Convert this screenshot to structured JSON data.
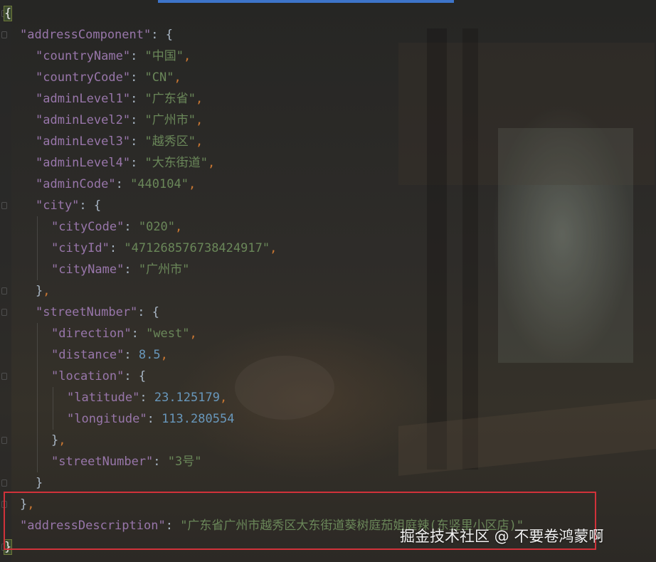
{
  "watermark": "掘金技术社区 @ 不要卷鸿蒙啊",
  "lines": [
    {
      "indent": 0,
      "tokens": [
        {
          "t": "{",
          "c": "brace-hl"
        }
      ]
    },
    {
      "indent": 1,
      "tokens": [
        {
          "t": "\"addressComponent\"",
          "c": "key"
        },
        {
          "t": ": ",
          "c": "brace"
        },
        {
          "t": "{",
          "c": "brace"
        }
      ]
    },
    {
      "indent": 2,
      "tokens": [
        {
          "t": "\"countryName\"",
          "c": "key"
        },
        {
          "t": ": ",
          "c": "brace"
        },
        {
          "t": "\"中国\"",
          "c": "str"
        },
        {
          "t": ",",
          "c": "punct"
        }
      ]
    },
    {
      "indent": 2,
      "tokens": [
        {
          "t": "\"countryCode\"",
          "c": "key"
        },
        {
          "t": ": ",
          "c": "brace"
        },
        {
          "t": "\"CN\"",
          "c": "str"
        },
        {
          "t": ",",
          "c": "punct"
        }
      ]
    },
    {
      "indent": 2,
      "tokens": [
        {
          "t": "\"adminLevel1\"",
          "c": "key"
        },
        {
          "t": ": ",
          "c": "brace"
        },
        {
          "t": "\"广东省\"",
          "c": "str"
        },
        {
          "t": ",",
          "c": "punct"
        }
      ]
    },
    {
      "indent": 2,
      "tokens": [
        {
          "t": "\"adminLevel2\"",
          "c": "key"
        },
        {
          "t": ": ",
          "c": "brace"
        },
        {
          "t": "\"广州市\"",
          "c": "str"
        },
        {
          "t": ",",
          "c": "punct"
        }
      ]
    },
    {
      "indent": 2,
      "tokens": [
        {
          "t": "\"adminLevel3\"",
          "c": "key"
        },
        {
          "t": ": ",
          "c": "brace"
        },
        {
          "t": "\"越秀区\"",
          "c": "str"
        },
        {
          "t": ",",
          "c": "punct"
        }
      ]
    },
    {
      "indent": 2,
      "tokens": [
        {
          "t": "\"adminLevel4\"",
          "c": "key"
        },
        {
          "t": ": ",
          "c": "brace"
        },
        {
          "t": "\"大东街道\"",
          "c": "str"
        },
        {
          "t": ",",
          "c": "punct"
        }
      ]
    },
    {
      "indent": 2,
      "tokens": [
        {
          "t": "\"adminCode\"",
          "c": "key"
        },
        {
          "t": ": ",
          "c": "brace"
        },
        {
          "t": "\"440104\"",
          "c": "str"
        },
        {
          "t": ",",
          "c": "punct"
        }
      ]
    },
    {
      "indent": 2,
      "tokens": [
        {
          "t": "\"city\"",
          "c": "key"
        },
        {
          "t": ": ",
          "c": "brace"
        },
        {
          "t": "{",
          "c": "brace"
        }
      ]
    },
    {
      "indent": 3,
      "tokens": [
        {
          "t": "\"cityCode\"",
          "c": "key"
        },
        {
          "t": ": ",
          "c": "brace"
        },
        {
          "t": "\"020\"",
          "c": "str"
        },
        {
          "t": ",",
          "c": "punct"
        }
      ]
    },
    {
      "indent": 3,
      "tokens": [
        {
          "t": "\"cityId\"",
          "c": "key"
        },
        {
          "t": ": ",
          "c": "brace"
        },
        {
          "t": "\"471268576738424917\"",
          "c": "str"
        },
        {
          "t": ",",
          "c": "punct"
        }
      ]
    },
    {
      "indent": 3,
      "tokens": [
        {
          "t": "\"cityName\"",
          "c": "key"
        },
        {
          "t": ": ",
          "c": "brace"
        },
        {
          "t": "\"广州市\"",
          "c": "str"
        }
      ]
    },
    {
      "indent": 2,
      "tokens": [
        {
          "t": "}",
          "c": "brace"
        },
        {
          "t": ",",
          "c": "punct"
        }
      ]
    },
    {
      "indent": 2,
      "tokens": [
        {
          "t": "\"streetNumber\"",
          "c": "key"
        },
        {
          "t": ": ",
          "c": "brace"
        },
        {
          "t": "{",
          "c": "brace"
        }
      ]
    },
    {
      "indent": 3,
      "tokens": [
        {
          "t": "\"direction\"",
          "c": "key"
        },
        {
          "t": ": ",
          "c": "brace"
        },
        {
          "t": "\"west\"",
          "c": "str"
        },
        {
          "t": ",",
          "c": "punct"
        }
      ]
    },
    {
      "indent": 3,
      "tokens": [
        {
          "t": "\"distance\"",
          "c": "key"
        },
        {
          "t": ": ",
          "c": "brace"
        },
        {
          "t": "8.5",
          "c": "num"
        },
        {
          "t": ",",
          "c": "punct"
        }
      ]
    },
    {
      "indent": 3,
      "tokens": [
        {
          "t": "\"location\"",
          "c": "key"
        },
        {
          "t": ": ",
          "c": "brace"
        },
        {
          "t": "{",
          "c": "brace"
        }
      ]
    },
    {
      "indent": 4,
      "tokens": [
        {
          "t": "\"latitude\"",
          "c": "key"
        },
        {
          "t": ": ",
          "c": "brace"
        },
        {
          "t": "23.125179",
          "c": "num"
        },
        {
          "t": ",",
          "c": "punct"
        }
      ]
    },
    {
      "indent": 4,
      "tokens": [
        {
          "t": "\"longitude\"",
          "c": "key"
        },
        {
          "t": ": ",
          "c": "brace"
        },
        {
          "t": "113.280554",
          "c": "num"
        }
      ]
    },
    {
      "indent": 3,
      "tokens": [
        {
          "t": "}",
          "c": "brace"
        },
        {
          "t": ",",
          "c": "punct"
        }
      ]
    },
    {
      "indent": 3,
      "tokens": [
        {
          "t": "\"streetNumber\"",
          "c": "key"
        },
        {
          "t": ": ",
          "c": "brace"
        },
        {
          "t": "\"3号\"",
          "c": "str"
        }
      ]
    },
    {
      "indent": 2,
      "tokens": [
        {
          "t": "}",
          "c": "brace"
        }
      ]
    },
    {
      "indent": 1,
      "tokens": [
        {
          "t": "}",
          "c": "brace"
        },
        {
          "t": ",",
          "c": "punct"
        }
      ]
    },
    {
      "indent": 1,
      "tokens": [
        {
          "t": "\"addressDescription\"",
          "c": "key"
        },
        {
          "t": ": ",
          "c": "brace"
        },
        {
          "t": "\"广东省广州市越秀区大东街道葵树庭茄姐庭辣(东竖里小区店)\"",
          "c": "str"
        }
      ]
    },
    {
      "indent": 0,
      "tokens": [
        {
          "t": "}",
          "c": "brace-hl"
        }
      ]
    }
  ]
}
